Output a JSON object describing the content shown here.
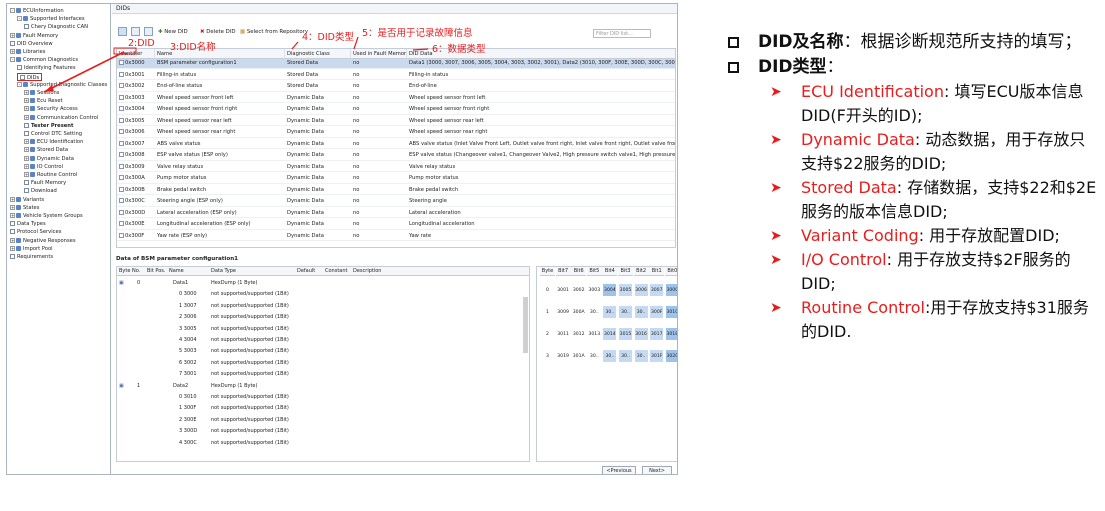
{
  "tree": [
    {
      "label": "ECUInformation",
      "indent": 0,
      "ex": "-"
    },
    {
      "label": "Supported Interfaces",
      "indent": 1,
      "ex": "-"
    },
    {
      "label": "Chery Diagnostic CAN",
      "indent": 2,
      "doc": true
    },
    {
      "label": "Fault Memory",
      "indent": 0,
      "ex": "+"
    },
    {
      "label": "DID Overview",
      "indent": 0,
      "doc": true
    },
    {
      "label": "Libraries",
      "indent": 0,
      "ex": "+"
    },
    {
      "label": "Common Diagnostics",
      "indent": 0,
      "ex": "-"
    },
    {
      "label": "Identifying Features",
      "indent": 1,
      "doc": true
    },
    {
      "label": "DIDs",
      "indent": 1,
      "doc": true,
      "sel": true
    },
    {
      "label": "Supported Diagnostic Classes",
      "indent": 1,
      "ex": "-"
    },
    {
      "label": "Sessions",
      "indent": 2,
      "ex": "+"
    },
    {
      "label": "Ecu Reset",
      "indent": 2,
      "ex": "+"
    },
    {
      "label": "Security Access",
      "indent": 2,
      "ex": "+"
    },
    {
      "label": "Communication Control",
      "indent": 2,
      "ex": "+"
    },
    {
      "label": "Tester Present",
      "indent": 2,
      "doc": true,
      "bold": true
    },
    {
      "label": "Control DTC Setting",
      "indent": 2,
      "doc": true
    },
    {
      "label": "ECU Identification",
      "indent": 2,
      "ex": "+"
    },
    {
      "label": "Stored Data",
      "indent": 2,
      "ex": "+"
    },
    {
      "label": "Dynamic Data",
      "indent": 2,
      "ex": "+"
    },
    {
      "label": "IO Control",
      "indent": 2,
      "ex": "+"
    },
    {
      "label": "Routine Control",
      "indent": 2,
      "ex": "+"
    },
    {
      "label": "Fault Memory",
      "indent": 2,
      "doc": true
    },
    {
      "label": "Download",
      "indent": 2,
      "doc": true
    },
    {
      "label": "Variants",
      "indent": 0,
      "ex": "+"
    },
    {
      "label": "States",
      "indent": 0,
      "ex": "+"
    },
    {
      "label": "Vehicle System Groups",
      "indent": 0,
      "ex": "+"
    },
    {
      "label": "Data Types",
      "indent": 0,
      "doc": true
    },
    {
      "label": "Protocol Services",
      "indent": 0,
      "doc": true
    },
    {
      "label": "Negative Responses",
      "indent": 0,
      "ex": "+"
    },
    {
      "label": "Import Pool",
      "indent": 0,
      "ex": "+"
    },
    {
      "label": "Requirements",
      "indent": 0,
      "doc": true
    }
  ],
  "main_title": "DIDs",
  "toolbar": {
    "new_did": "New DID",
    "delete_did": "Delete DID",
    "select_repo": "Select from Repository"
  },
  "filter_placeholder": "Filter DID list...",
  "grid_headers": {
    "identifier": "Identifier",
    "name": "Name",
    "diag_class": "Diagnostic Class",
    "fault_memory": "Used in Fault Memory",
    "did_data": "DID Data"
  },
  "dids": [
    {
      "id": "0x3000",
      "name": "BSM parameter configuration1",
      "cls": "Stored Data",
      "fm": "no",
      "data": "Data1 (3000, 3007, 3006, 3005, 3004, 3003, 3002, 3001), Data2 (3010, 300F, 300E, 300D, 300C, 300B, 300A, 3009)"
    },
    {
      "id": "0x3001",
      "name": "Filling-in status",
      "cls": "Stored Data",
      "fm": "no",
      "data": "Filling-in status"
    },
    {
      "id": "0x3002",
      "name": "End-of-line status",
      "cls": "Stored Data",
      "fm": "no",
      "data": "End-of-line"
    },
    {
      "id": "0x3003",
      "name": "Wheel speed sensor front left",
      "cls": "Dynamic Data",
      "fm": "no",
      "data": "Wheel speed sensor front left"
    },
    {
      "id": "0x3004",
      "name": "Wheel speed sensor front right",
      "cls": "Dynamic Data",
      "fm": "no",
      "data": "Wheel speed sensor front right"
    },
    {
      "id": "0x3005",
      "name": "Wheel speed sensor rear left",
      "cls": "Dynamic Data",
      "fm": "no",
      "data": "Wheel speed sensor rear left"
    },
    {
      "id": "0x3006",
      "name": "Wheel speed sensor rear right",
      "cls": "Dynamic Data",
      "fm": "no",
      "data": "Wheel speed sensor rear right"
    },
    {
      "id": "0x3007",
      "name": "ABS valve status",
      "cls": "Dynamic Data",
      "fm": "no",
      "data": "ABS valve status (Inlet Valve Front Left, Outlet valve front right, Inlet valve front right, Outlet valve front right, Inlet valv..."
    },
    {
      "id": "0x3008",
      "name": "ESP valve status (ESP only)",
      "cls": "Dynamic Data",
      "fm": "no",
      "data": "ESP valve status (Changeover valve1, Changeover Valve2, High pressure switch valve1, High pressure switch valv..."
    },
    {
      "id": "0x3009",
      "name": "Valve relay status",
      "cls": "Dynamic Data",
      "fm": "no",
      "data": "Valve relay status"
    },
    {
      "id": "0x300A",
      "name": "Pump motor status",
      "cls": "Dynamic Data",
      "fm": "no",
      "data": "Pump motor status"
    },
    {
      "id": "0x300B",
      "name": "Brake pedal switch",
      "cls": "Dynamic Data",
      "fm": "no",
      "data": "Brake pedal switch"
    },
    {
      "id": "0x300C",
      "name": "Steering angle (ESP only)",
      "cls": "Dynamic Data",
      "fm": "no",
      "data": "Steering angle"
    },
    {
      "id": "0x300D",
      "name": "Lateral acceleration (ESP only)",
      "cls": "Dynamic Data",
      "fm": "no",
      "data": "Lateral acceleration"
    },
    {
      "id": "0x300E",
      "name": "Longitudinal acceleration (ESP only)",
      "cls": "Dynamic Data",
      "fm": "no",
      "data": "Longitudinal acceleration"
    },
    {
      "id": "0x300F",
      "name": "Yaw rate (ESP only)",
      "cls": "Dynamic Data",
      "fm": "no",
      "data": "Yaw rate"
    }
  ],
  "detail_title": "Data of BSM parameter configuration1",
  "detail_headers": {
    "byte": "Byte No.",
    "bit": "Bit Pos.",
    "name": "Name",
    "type": "Data Type",
    "def": "Default",
    "const": "Constant",
    "desc": "Description"
  },
  "detail_rows": [
    {
      "byte": "0",
      "bit": "",
      "name": "Data1",
      "type": "HexDump (1 Byte)"
    },
    {
      "byte": "",
      "bit": "",
      "name": "0 3000",
      "type": "not supported/supported (1Bit)"
    },
    {
      "byte": "",
      "bit": "",
      "name": "1 3007",
      "type": "not supported/supported (1Bit)"
    },
    {
      "byte": "",
      "bit": "",
      "name": "2 3006",
      "type": "not supported/supported (1Bit)"
    },
    {
      "byte": "",
      "bit": "",
      "name": "3 3005",
      "type": "not supported/supported (1Bit)"
    },
    {
      "byte": "",
      "bit": "",
      "name": "4 3004",
      "type": "not supported/supported (1Bit)"
    },
    {
      "byte": "",
      "bit": "",
      "name": "5 3003",
      "type": "not supported/supported (1Bit)"
    },
    {
      "byte": "",
      "bit": "",
      "name": "6 3002",
      "type": "not supported/supported (1Bit)"
    },
    {
      "byte": "",
      "bit": "",
      "name": "7 3001",
      "type": "not supported/supported (1Bit)"
    },
    {
      "byte": "1",
      "bit": "",
      "name": "Data2",
      "type": "HexDump (1 Byte)"
    },
    {
      "byte": "",
      "bit": "",
      "name": "0 3010",
      "type": "not supported/supported (1Bit)"
    },
    {
      "byte": "",
      "bit": "",
      "name": "1 300F",
      "type": "not supported/supported (1Bit)"
    },
    {
      "byte": "",
      "bit": "",
      "name": "2 300E",
      "type": "not supported/supported (1Bit)"
    },
    {
      "byte": "",
      "bit": "",
      "name": "3 300D",
      "type": "not supported/supported (1Bit)"
    },
    {
      "byte": "",
      "bit": "",
      "name": "4 300C",
      "type": "not supported/supported (1Bit)"
    }
  ],
  "bit_headers": [
    "Byte",
    "Bit7",
    "Bit6",
    "Bit5",
    "Bit4",
    "Bit3",
    "Bit2",
    "Bit1",
    "Bit0"
  ],
  "bit_rows": [
    [
      "0",
      "3001",
      "3002",
      "3003",
      "3004",
      "3005",
      "3006",
      "3007",
      "3000"
    ],
    [
      "1",
      "3009",
      "300A",
      "30..",
      "30..",
      "30..",
      "30..",
      "300F",
      "3010"
    ],
    [
      "2",
      "3011",
      "3012",
      "3013",
      "3014",
      "3015",
      "3016",
      "3017",
      "3018"
    ],
    [
      "3",
      "3019",
      "301A",
      "30..",
      "30..",
      "30..",
      "30..",
      "301F",
      "3020"
    ]
  ],
  "nav": {
    "prev": "<Previous",
    "next": "Next>"
  },
  "annotations": {
    "a2": "2:DID",
    "a3": "3:DID名称",
    "a4": "4：DID类型",
    "a5": "5：是否用于记录故障信息",
    "a6": "6：数据类型"
  },
  "notes": {
    "b1_bold": "DID及名称",
    "b1_text": "：根据诊断规范所支持的填写；",
    "b2_bold": "DID类型",
    "b2_text": "：",
    "items": [
      {
        "red": "ECU Identification",
        "text": ": 填写ECU版本信息DID(F开头的ID);"
      },
      {
        "red": "Dynamic Data",
        "text": ": 动态数据，用于存放只支持$22服务的DID;"
      },
      {
        "red": "Stored Data",
        "text": ": 存储数据，支持$22和$2E服务的版本信息DID;"
      },
      {
        "red": "Variant Coding",
        "text": ": 用于存放配置DID;"
      },
      {
        "red": "I/O Control",
        "text": ": 用于存放支持$2F服务的DID;"
      },
      {
        "red": "Routine Control",
        "text": ":用于存放支持$31服务的DID."
      }
    ]
  },
  "colors": {
    "accent_red": "#e81c1c",
    "selection": "#c9d9ee"
  }
}
